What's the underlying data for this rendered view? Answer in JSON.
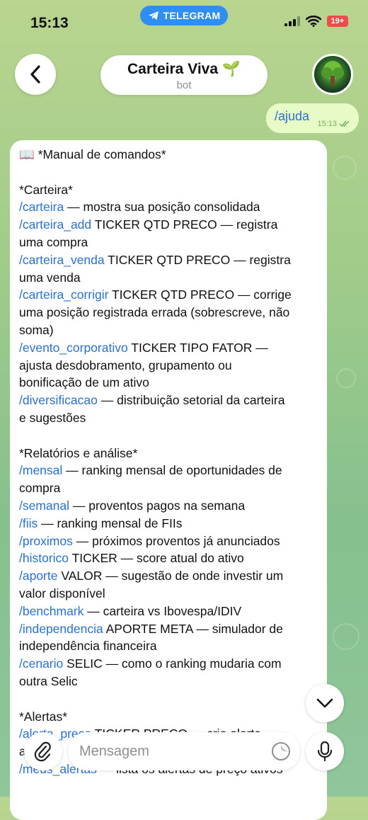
{
  "status_bar": {
    "time": "15:13",
    "app_pill": "TELEGRAM",
    "battery": "19+"
  },
  "header": {
    "title": "Carteira Viva 🌱",
    "subtitle": "bot"
  },
  "outgoing": {
    "text": "/ajuda",
    "time": "15:13"
  },
  "incoming": {
    "lines": [
      {
        "cmd": "",
        "text": "📖 *Manual de comandos*"
      },
      {
        "cmd": "",
        "text": ""
      },
      {
        "cmd": "",
        "text": "*Carteira*"
      },
      {
        "cmd": "/carteira",
        "text": " — mostra sua posição consolidada"
      },
      {
        "cmd": "/carteira_add",
        "text": " TICKER QTD PRECO — registra"
      },
      {
        "cmd": "",
        "text": "uma compra"
      },
      {
        "cmd": "/carteira_venda",
        "text": " TICKER QTD PRECO — registra"
      },
      {
        "cmd": "",
        "text": "uma venda"
      },
      {
        "cmd": "/carteira_corrigir",
        "text": " TICKER QTD PRECO — corrige"
      },
      {
        "cmd": "",
        "text": "uma posição registrada errada (sobrescreve, não"
      },
      {
        "cmd": "",
        "text": "soma)"
      },
      {
        "cmd": "/evento_corporativo",
        "text": " TICKER TIPO FATOR —"
      },
      {
        "cmd": "",
        "text": "ajusta desdobramento, grupamento ou"
      },
      {
        "cmd": "",
        "text": "bonificação de um ativo"
      },
      {
        "cmd": "/diversificacao",
        "text": " — distribuição setorial da carteira"
      },
      {
        "cmd": "",
        "text": "e sugestões"
      },
      {
        "cmd": "",
        "text": ""
      },
      {
        "cmd": "",
        "text": "*Relatórios e análise*"
      },
      {
        "cmd": "/mensal",
        "text": " — ranking mensal de oportunidades de"
      },
      {
        "cmd": "",
        "text": "compra"
      },
      {
        "cmd": "/semanal",
        "text": " — proventos pagos na semana"
      },
      {
        "cmd": "/fiis",
        "text": " — ranking mensal de FIIs"
      },
      {
        "cmd": "/proximos",
        "text": " — próximos proventos já anunciados"
      },
      {
        "cmd": "/historico",
        "text": " TICKER — score atual do ativo"
      },
      {
        "cmd": "/aporte",
        "text": " VALOR — sugestão de onde investir um"
      },
      {
        "cmd": "",
        "text": "valor disponível"
      },
      {
        "cmd": "/benchmark",
        "text": " — carteira vs Ibovespa/IDIV"
      },
      {
        "cmd": "/independencia",
        "text": " APORTE META — simulador de"
      },
      {
        "cmd": "",
        "text": "independência financeira"
      },
      {
        "cmd": "/cenario",
        "text": " SELIC — como o ranking mudaria com"
      },
      {
        "cmd": "",
        "text": "outra Selic"
      },
      {
        "cmd": "",
        "text": ""
      },
      {
        "cmd": "",
        "text": "*Alertas*"
      },
      {
        "cmd": "/alerta_preco",
        "text": " TICKER PRECO — cria alerta"
      },
      {
        "cmd": "",
        "text": "a"
      },
      {
        "cmd": "/meus_alertas",
        "text": " — lista os alertas de preço ativos"
      }
    ]
  },
  "composer": {
    "placeholder": "Mensagem"
  },
  "icons": {
    "back": "chevron-left-icon",
    "attach": "paperclip-icon",
    "sticker": "sticker-icon",
    "mic": "microphone-icon",
    "scroll": "chevron-down-icon",
    "telegram": "telegram-plane-icon"
  },
  "colors": {
    "link": "#2a6fd1",
    "outgoing_bubble": "#e6fbc6",
    "telegram_pill": "#2f8ef2",
    "battery": "#ef4b4b"
  }
}
